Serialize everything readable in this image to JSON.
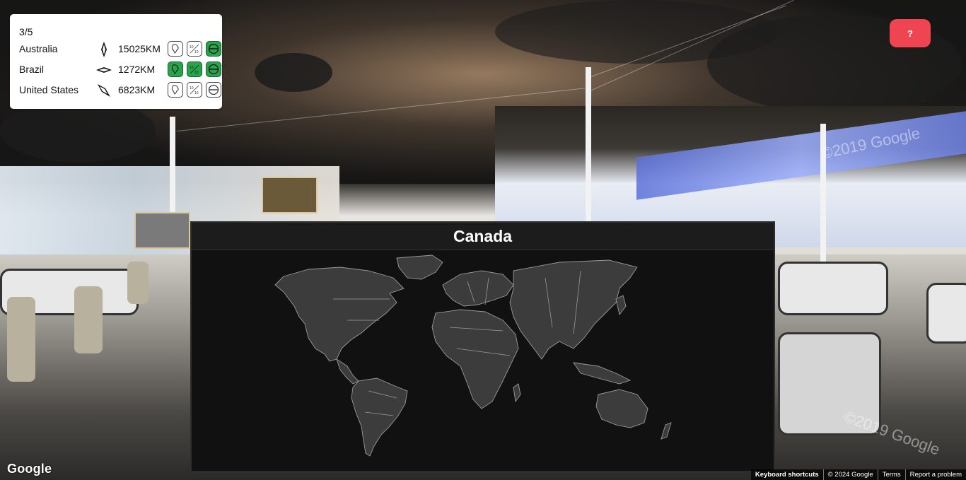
{
  "game": {
    "round_label": "3/5",
    "help_label": "?",
    "guesses": [
      {
        "country": "Australia",
        "direction_icon": "north-arrow-icon",
        "distance": "15025KM",
        "hints": [
          {
            "icon": "continent-icon",
            "active": false
          },
          {
            "icon": "population-icon",
            "active": false
          },
          {
            "icon": "hemisphere-icon",
            "active": true
          }
        ]
      },
      {
        "country": "Brazil",
        "direction_icon": "east-west-arrow-icon",
        "distance": "1272KM",
        "hints": [
          {
            "icon": "continent-icon",
            "active": true
          },
          {
            "icon": "population-icon",
            "active": true
          },
          {
            "icon": "hemisphere-icon",
            "active": true
          }
        ]
      },
      {
        "country": "United States",
        "direction_icon": "southeast-arrow-icon",
        "distance": "6823KM",
        "hints": [
          {
            "icon": "continent-icon",
            "active": false
          },
          {
            "icon": "population-icon",
            "active": false
          },
          {
            "icon": "hemisphere-icon",
            "active": false
          }
        ]
      }
    ],
    "map_title": "Canada"
  },
  "colors": {
    "hint_active": "#28a44b",
    "help_button": "#ef4452",
    "map_background": "#111111",
    "land_fill": "#3c3c3c"
  },
  "google": {
    "logo": "Google",
    "footer": [
      "Keyboard shortcuts",
      "© 2024 Google",
      "Terms",
      "Report a problem"
    ],
    "watermark": "©2019 Google"
  }
}
